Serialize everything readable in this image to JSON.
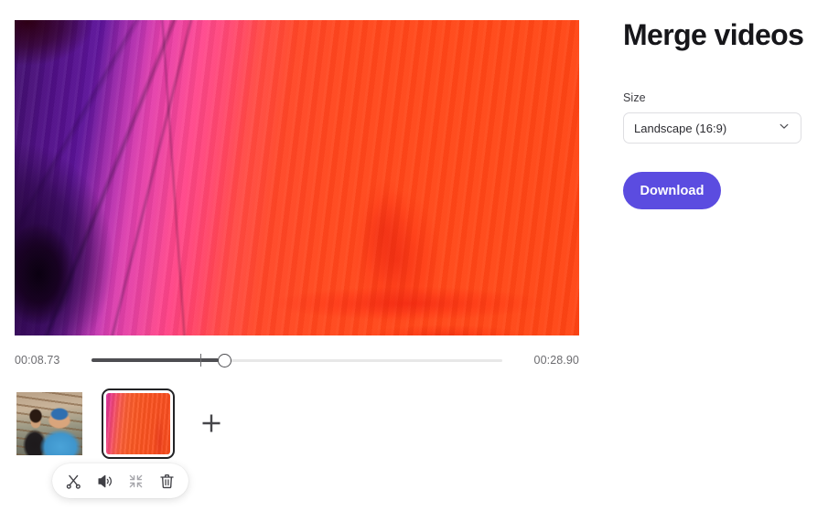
{
  "panel": {
    "title": "Merge videos",
    "size_label": "Size",
    "size_value": "Landscape (16:9)",
    "size_options": [
      "Landscape (16:9)"
    ],
    "download_label": "Download",
    "accent_color": "#5b4ce0"
  },
  "player": {
    "time_start": "00:08.73",
    "time_end": "00:28.90",
    "progress_percent": 31
  },
  "clips": [
    {
      "name": "clip-1",
      "selected": false
    },
    {
      "name": "clip-2",
      "selected": true
    }
  ],
  "add_clip": {
    "icon": "plus-icon"
  },
  "toolbar": {
    "buttons": [
      {
        "icon": "scissors-icon",
        "name": "trim-button"
      },
      {
        "icon": "volume-icon",
        "name": "volume-button"
      },
      {
        "icon": "compress-icon",
        "name": "fit-button"
      },
      {
        "icon": "trash-icon",
        "name": "delete-button"
      }
    ]
  }
}
